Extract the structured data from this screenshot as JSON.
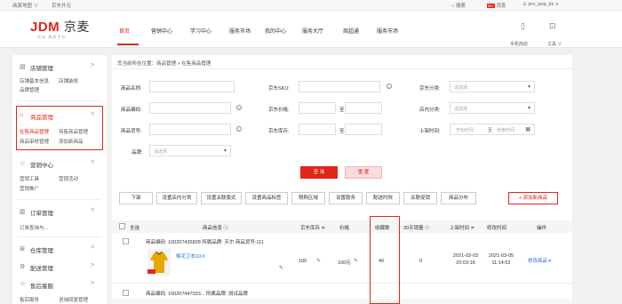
{
  "topbar": {
    "left_items": [
      "商家地图 ∨",
      "京东开元"
    ],
    "search": "搜索",
    "messages": "消息",
    "message_count": "99+",
    "user": "pro_pop_kk"
  },
  "header": {
    "logo_brand": "JDM",
    "logo_name": "京麦",
    "logo_sub": "京东·商家平台",
    "nav": [
      "首页",
      "营销中心",
      "学习中心",
      "服务市场",
      "我的中心",
      "服务大厅",
      "商超通",
      "服务市场"
    ],
    "right_items": [
      "手机商店",
      "工具"
    ]
  },
  "sidebar": {
    "sections": [
      {
        "title": "店铺管理",
        "items": [
          "店铺基本信息",
          "店铺装修",
          "品牌管理"
        ]
      },
      {
        "title": "商品管理",
        "items": [
          "在售商品管理",
          "待售商品管理",
          "商品审核管理",
          "添加新商品"
        ]
      },
      {
        "title": "营销中心",
        "items": [
          "营销工具",
          "营销活动",
          "营销推广"
        ]
      },
      {
        "title": "订单管理",
        "items": [
          "订单查询与..."
        ]
      },
      {
        "title": "仓库管理",
        "items": []
      },
      {
        "title": "配送管理",
        "items": []
      },
      {
        "title": "售后客服",
        "items": [
          "售后服务",
          "咨询回复管理"
        ]
      }
    ]
  },
  "main": {
    "breadcrumb": "您当前所在位置：商品管理 > 在售商品管理",
    "filters": {
      "name_label": "商品名称:",
      "sku_label": "京东SKU:",
      "category_label": "京东分类:",
      "category_ph": "请选择",
      "code_label": "商品编码:",
      "price_label": "京东价格:",
      "price_to": "至",
      "shop_cat_label": "店内分类:",
      "shop_cat_ph": "请选择",
      "goods_no_label": "商品货号:",
      "stock_label": "京东库存:",
      "stock_to": "至",
      "listing_time_label": "上架时间:",
      "start_ph": "开始时间",
      "end_ph": "结束时间",
      "time_to": "至",
      "brand_label": "品牌:",
      "brand_ph": "请选择"
    },
    "query_button": "查 询",
    "reset_button": "重 置",
    "toolbar": [
      "下架",
      "设置店内分类",
      "设置关联版式",
      "设置商品标签",
      "限购区域",
      "设置服务",
      "配送时效",
      "关联促销",
      "商品分布"
    ],
    "add_button": "+ 添加新商品",
    "columns": [
      "全选",
      "商品信息 ⓘ",
      "京东库存 ≑",
      "价格",
      "收藏数",
      "30天销量 ⓘ",
      "上架时间 ≑",
      "修改时间",
      "操作"
    ],
    "rows": [
      {
        "info": "商品编码: 100207435828 所属品牌: 天尔 商品货号:111",
        "name": "棉花卫衣XXX",
        "stock": "100",
        "price": "100元",
        "favorites": "40",
        "sales": "0",
        "listed": "2021-03-03 20:03:18",
        "modified": "2021-03-05 11:14:53",
        "action": "修改商品 ▾"
      },
      {
        "info": "商品编码: 100207447033... 所属品牌: 测试品牌"
      }
    ]
  },
  "colors": {
    "accent": "#e1251b"
  }
}
